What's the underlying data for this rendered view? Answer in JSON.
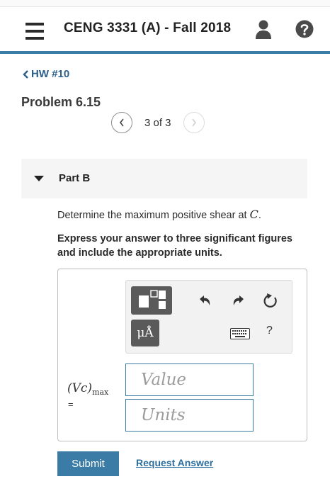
{
  "header": {
    "course_title": "CENG 3331 (A) - Fall 2018",
    "menu_icon": "hamburger-menu-icon",
    "user_icon": "user-icon",
    "help_icon": "help-circle-icon"
  },
  "nav": {
    "back_label": "HW #10"
  },
  "problem": {
    "title": "Problem 6.15",
    "pager_text": "3 of 3"
  },
  "part": {
    "label": "Part B",
    "expanded": true
  },
  "question": {
    "text_before": "Determine the maximum positive shear at ",
    "variable": "C",
    "text_after": ".",
    "instructions": "Express your answer to three significant figures and include the appropriate units."
  },
  "answer": {
    "label_main": "(Vc)",
    "label_sub": "max",
    "equals": "=",
    "value_placeholder": "Value",
    "units_placeholder": "Units",
    "toolbar": {
      "units_button": "μÅ",
      "help": "?"
    }
  },
  "actions": {
    "submit_label": "Submit",
    "request_label": "Request Answer"
  },
  "colors": {
    "accent": "#3a7ca5",
    "link": "#2c5f8a"
  }
}
